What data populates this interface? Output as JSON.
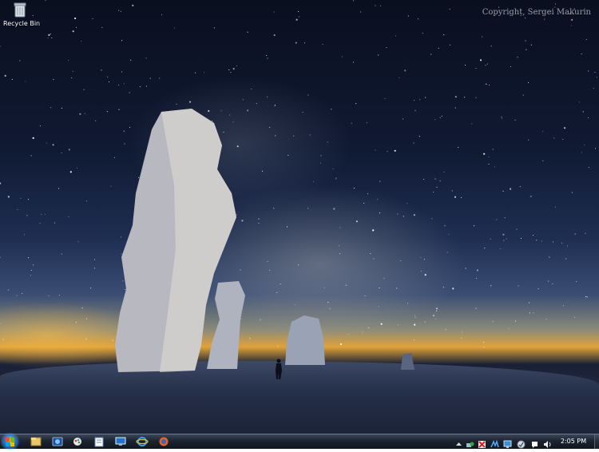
{
  "desktop": {
    "icons": [
      {
        "label": "Recycle Bin",
        "icon": "recycle-bin-icon"
      }
    ],
    "watermark": "Copyright, Sergei Makurin"
  },
  "taskbar": {
    "pinned": [
      {
        "name": "windows-explorer-icon"
      },
      {
        "name": "media-center-icon"
      },
      {
        "name": "paint-icon"
      },
      {
        "name": "wordpad-icon"
      },
      {
        "name": "remote-desktop-icon"
      },
      {
        "name": "internet-explorer-icon"
      },
      {
        "name": "firefox-icon"
      }
    ],
    "tray_icons": [
      "show-hidden-icons-icon",
      "network-icon",
      "security-icon",
      "bluetooth-icon",
      "monitor-icon",
      "update-icon",
      "action-center-icon",
      "volume-icon"
    ],
    "clock": "2:05 PM"
  }
}
